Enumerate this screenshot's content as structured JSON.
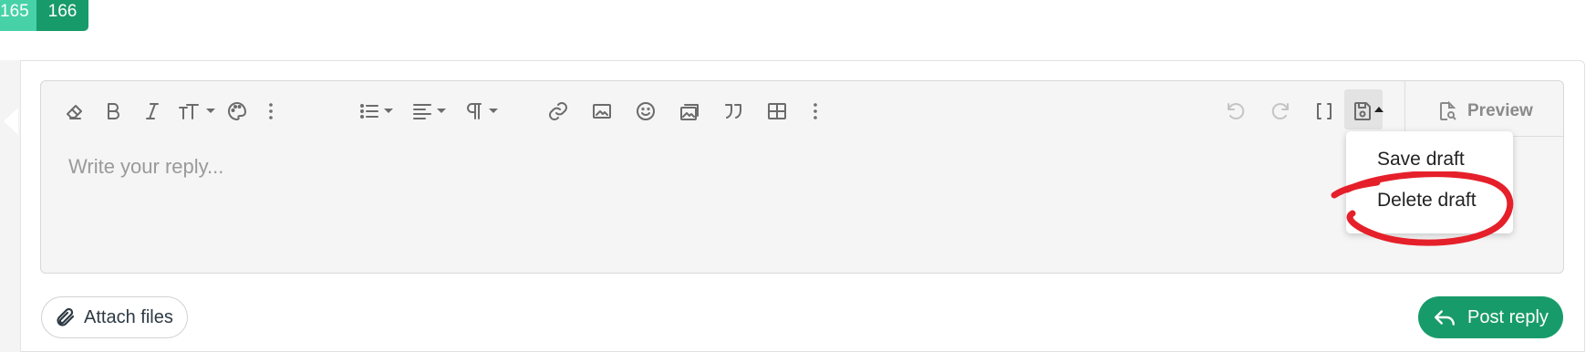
{
  "pagination": {
    "prev_page": "165",
    "current_page": "166"
  },
  "editor": {
    "placeholder": "Write your reply...",
    "toolbar_left": [
      "eraser-icon",
      "bold-icon",
      "italic-icon",
      "text-size-icon",
      "palette-icon",
      "more-vertical-icon",
      "list-icon",
      "align-icon",
      "paragraph-icon",
      "link-icon",
      "image-icon",
      "smiley-icon",
      "media-icon",
      "quote-icon",
      "table-icon",
      "more-vertical-icon"
    ],
    "toolbar_right": [
      "undo-icon",
      "redo-icon",
      "bracket-toggle-icon",
      "save-draft-icon"
    ],
    "preview_label": "Preview"
  },
  "draft_menu": {
    "save_label": "Save draft",
    "delete_label": "Delete draft"
  },
  "actions": {
    "attach_label": "Attach files",
    "post_label": "Post reply"
  },
  "colors": {
    "brand": "#189b6a",
    "brand_light": "#47d1a7",
    "annotation": "#e5202a"
  }
}
